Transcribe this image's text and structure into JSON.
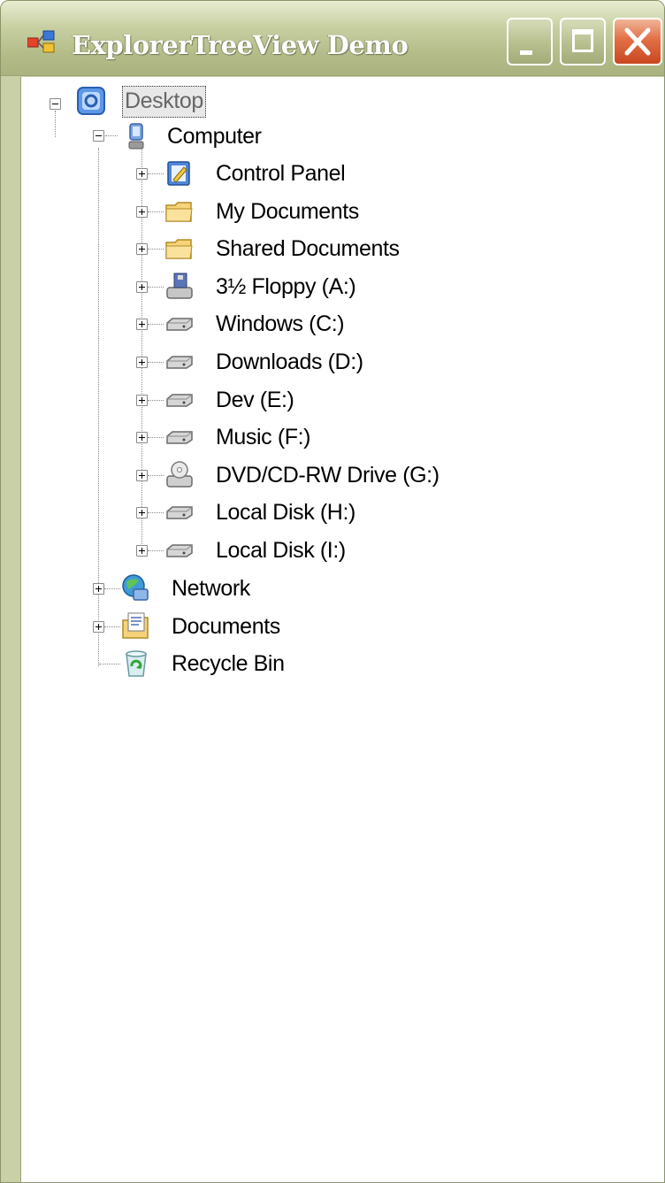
{
  "window": {
    "title": "ExplorerTreeView Demo",
    "controls": {
      "minimize": "minimize-icon",
      "maximize": "maximize-icon",
      "close": "close-icon"
    }
  },
  "tree": {
    "root": {
      "label": "Desktop",
      "icon": "desktop-icon",
      "expanded": true,
      "selected": true
    },
    "computer": {
      "label": "Computer",
      "icon": "computer-icon",
      "expanded": true
    },
    "computer_items": [
      {
        "label": "Control Panel",
        "icon": "control-panel-icon"
      },
      {
        "label": "My Documents",
        "icon": "folder-icon"
      },
      {
        "label": "Shared Documents",
        "icon": "folder-icon"
      },
      {
        "label": "3½ Floppy (A:)",
        "icon": "floppy-drive-icon"
      },
      {
        "label": "Windows (C:)",
        "icon": "hard-drive-icon"
      },
      {
        "label": "Downloads (D:)",
        "icon": "hard-drive-icon"
      },
      {
        "label": "Dev (E:)",
        "icon": "hard-drive-icon"
      },
      {
        "label": "Music (F:)",
        "icon": "hard-drive-icon"
      },
      {
        "label": "DVD/CD-RW Drive (G:)",
        "icon": "dvd-drive-icon"
      },
      {
        "label": "Local Disk (H:)",
        "icon": "hard-drive-icon"
      },
      {
        "label": "Local Disk (I:)",
        "icon": "hard-drive-icon"
      }
    ],
    "desktop_items": [
      {
        "label": "Network",
        "icon": "network-icon",
        "expandable": true
      },
      {
        "label": "Documents",
        "icon": "documents-icon",
        "expandable": true
      },
      {
        "label": "Recycle Bin",
        "icon": "recycle-bin-icon",
        "expandable": false
      }
    ]
  },
  "colors": {
    "titlebar": "#b4bd8a",
    "frame": "#c9cfa6",
    "close_button": "#e26f45",
    "selection_bg": "#e8e8e8"
  }
}
